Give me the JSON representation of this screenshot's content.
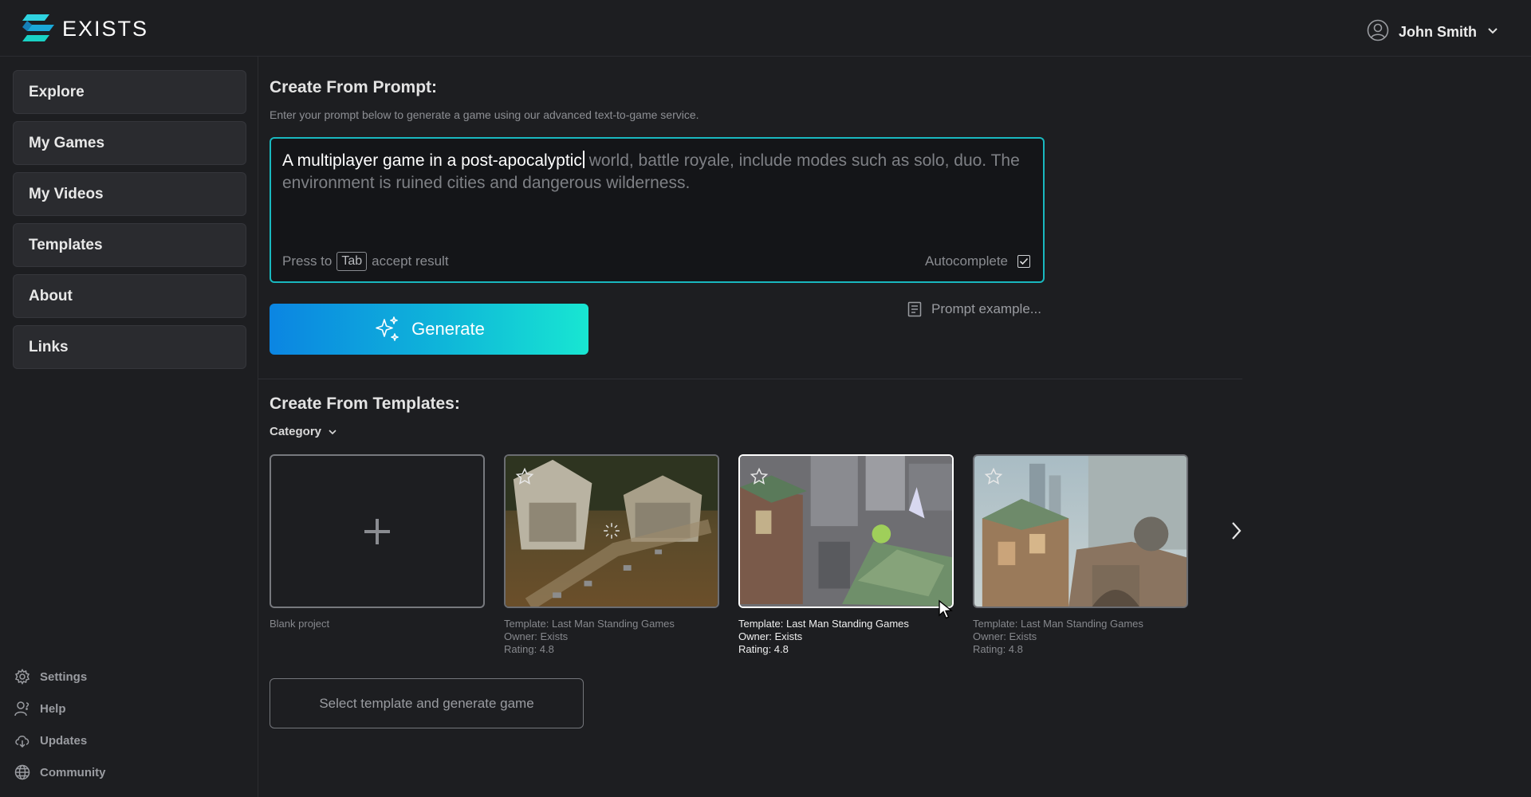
{
  "header": {
    "brand_name": "EXISTS",
    "user_name": "John Smith"
  },
  "sidebar": {
    "items": [
      {
        "label": "Explore"
      },
      {
        "label": "My Games"
      },
      {
        "label": "My Videos"
      },
      {
        "label": "Templates"
      },
      {
        "label": "About"
      },
      {
        "label": "Links"
      }
    ],
    "footer": [
      {
        "label": "Settings",
        "icon": "gear-icon"
      },
      {
        "label": "Help",
        "icon": "help-person-icon"
      },
      {
        "label": "Updates",
        "icon": "cloud-download-icon"
      },
      {
        "label": "Community",
        "icon": "globe-icon"
      }
    ]
  },
  "prompt_section": {
    "title": "Create From Prompt:",
    "subtitle": "Enter your prompt below to generate a game using our advanced text-to-game service.",
    "typed_text": "A multiplayer game in a post-apocalyptic",
    "suggestion_text": " world, battle royale, include modes such as solo, duo. The environment is ruined cities and dangerous wilderness.",
    "hint_prefix": "Press to",
    "hint_key": "Tab",
    "hint_suffix": "accept result",
    "autocomplete_label": "Autocomplete",
    "autocomplete_checked": true,
    "generate_label": "Generate",
    "prompt_example_label": "Prompt example..."
  },
  "templates_section": {
    "title": "Create From Templates:",
    "category_label": "Category",
    "blank_label": "Blank project",
    "cards": [
      {
        "template": "Template: Last Man Standing Games",
        "owner": "Owner: Exists",
        "rating": "Rating: 4.8",
        "selected": false
      },
      {
        "template": "Template: Last Man Standing Games",
        "owner": "Owner: Exists",
        "rating": "Rating: 4.8",
        "selected": true
      },
      {
        "template": "Template: Last Man Standing Games",
        "owner": "Owner: Exists",
        "rating": "Rating: 4.8",
        "selected": false
      }
    ],
    "select_button_label": "Select template and generate game"
  },
  "colors": {
    "accent": "#19b8bf",
    "gradient_start": "#0b85e2",
    "gradient_end": "#18e6d2",
    "background": "#1d1e21"
  }
}
